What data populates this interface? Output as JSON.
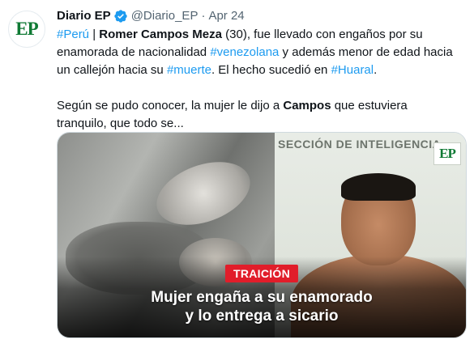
{
  "author": {
    "name": "Diario EP",
    "handle": "@Diario_EP",
    "separator": "·",
    "date": "Apr 24",
    "avatar_text": "EP",
    "verified_icon": "verified-badge-icon"
  },
  "tweet": {
    "line1": {
      "tag1": "#Perú",
      "sep": " | ",
      "bold": "Romer Campos Meza",
      "rest": " (30), fue llevado con engaños por su"
    },
    "line2": {
      "pre": "enamorada de nacionalidad ",
      "tag": "#venezolana",
      "post": " y además menor de edad hacia"
    },
    "line3": {
      "pre": "un callejón hacia su ",
      "tag1": "#muerte",
      "mid": ". El hecho sucedió en ",
      "tag2": "#Huaral",
      "post": "."
    },
    "line4": {
      "pre": "Según se pudo conocer, la mujer le dijo a ",
      "bold": "Campos",
      "post": " que estuviera"
    },
    "line5": "tranquilo, que todo se..."
  },
  "media": {
    "banner": "SECCIÓN DE INTELIGENCIA",
    "logo_text": "EP",
    "badge": "TRAICIÓN",
    "caption_line1": "Mujer engaña a su enamorado",
    "caption_line2": "y lo entrega a sicario"
  },
  "colors": {
    "link": "#1d9bf0",
    "verified": "#1d9bf0",
    "badge_bg": "#e11d2a",
    "brand_green": "#0f7a34"
  }
}
